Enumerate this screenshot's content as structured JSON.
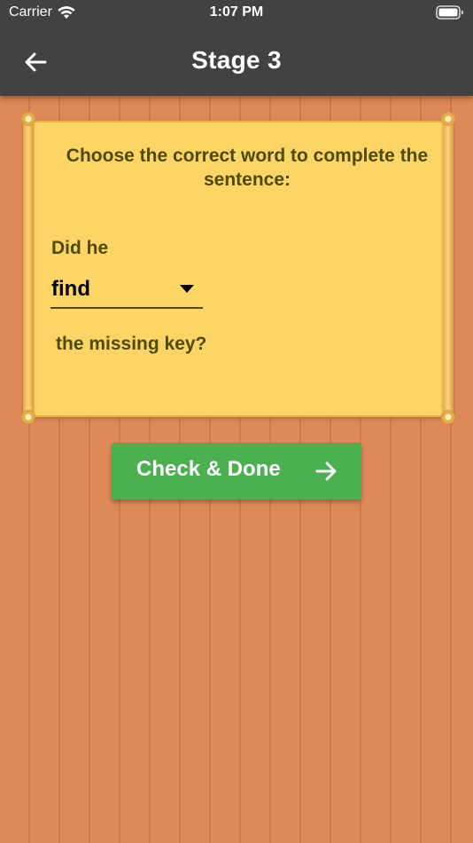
{
  "status_bar": {
    "carrier": "Carrier",
    "time": "1:07 PM",
    "icons": [
      "wifi-icon",
      "battery-icon"
    ]
  },
  "app_bar": {
    "back_icon": "arrow-left-icon",
    "title": "Stage 3"
  },
  "exercise": {
    "question": "Choose the correct word to complete the sentence:",
    "sentence_start": "Did he",
    "selected_word": "find",
    "dropdown_icon": "caret-down-icon",
    "sentence_end": "the missing key?"
  },
  "actions": {
    "check_label": "Check & Done",
    "check_icon": "arrow-right-icon"
  },
  "colors": {
    "app_bar": "#424242",
    "background": "#de8a58",
    "parchment": "#fdd466",
    "text": "#4f4a08",
    "button": "#4caf50"
  }
}
